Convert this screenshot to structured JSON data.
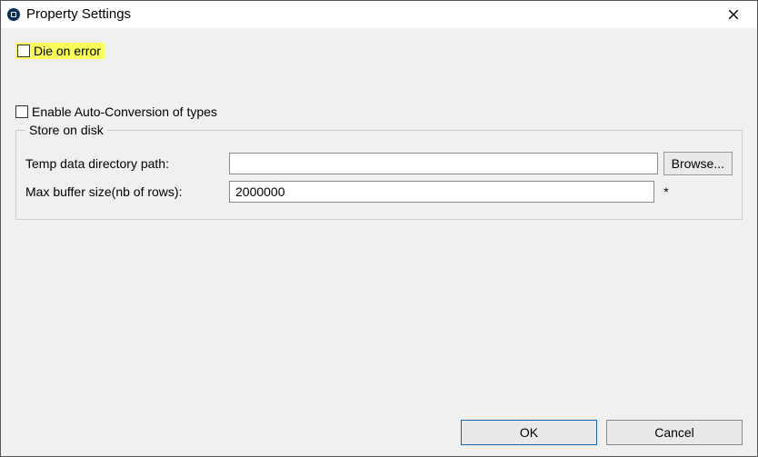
{
  "window": {
    "title": "Property Settings"
  },
  "checkboxes": {
    "die_on_error": {
      "label": "Die on error",
      "checked": false,
      "highlighted": true
    },
    "auto_convert": {
      "label": "Enable Auto-Conversion of types",
      "checked": false
    }
  },
  "group": {
    "legend": "Store on disk",
    "temp_path": {
      "label": "Temp data directory path:",
      "value": "",
      "browse_label": "Browse..."
    },
    "max_buffer": {
      "label": "Max buffer size(nb of rows):",
      "value": "2000000",
      "required_marker": "*"
    }
  },
  "footer": {
    "ok": "OK",
    "cancel": "Cancel"
  }
}
